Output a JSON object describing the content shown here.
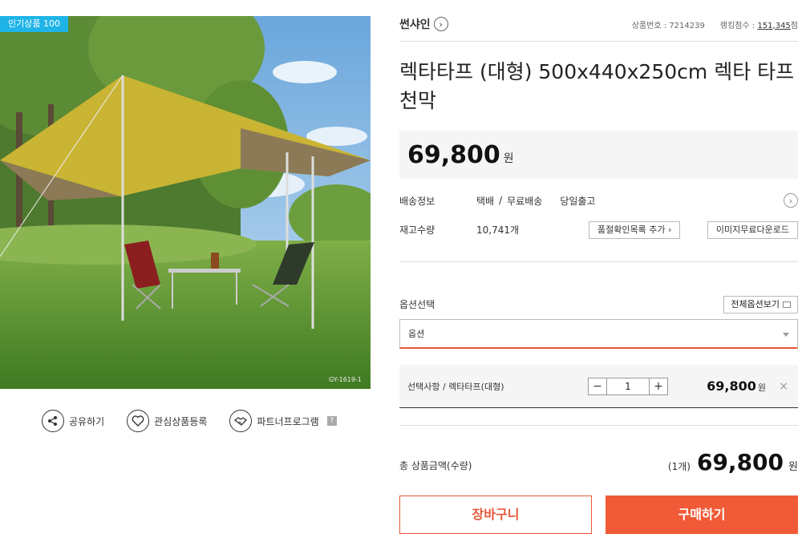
{
  "badge": {
    "popular": "인기상품 100"
  },
  "image": {
    "watermark": "GY-1619-1"
  },
  "actions": {
    "share": "공유하기",
    "wishlist": "관심상품등록",
    "partner": "파트너프로그램",
    "help": "?"
  },
  "product": {
    "brand": "썬샤인",
    "product_no_label": "상품번호 : 7214239",
    "ranking_label": "랭킹점수 : ",
    "ranking_value": "151,345",
    "ranking_unit": "점",
    "title": "렉타타프 (대형) 500x440x250cm 렉타 타프 천막",
    "price": "69,800",
    "currency": "원"
  },
  "shipping": {
    "label": "배송정보",
    "method": "택배",
    "fee": "무료배송",
    "release": "당일출고"
  },
  "stock": {
    "label": "재고수량",
    "value": "10,741개",
    "qc_button": "품절확인목록 추가",
    "image_button": "이미지무료다운로드"
  },
  "options": {
    "label": "옵션선택",
    "view_all": "전체옵션보기",
    "select_value": "옵션"
  },
  "selected": {
    "label": "선택사항 / 렉타타프(대형)",
    "quantity": "1",
    "minus": "−",
    "plus": "+",
    "price": "69,800",
    "currency": "원",
    "remove": "×"
  },
  "total": {
    "label": "총 상품금액(수량)",
    "qty": "(1개)",
    "amount": "69,800",
    "currency": "원"
  },
  "buttons": {
    "cart": "장바구니",
    "buy": "구매하기"
  },
  "colors": {
    "accent": "#f15a36",
    "badge": "#1fb4e8"
  }
}
